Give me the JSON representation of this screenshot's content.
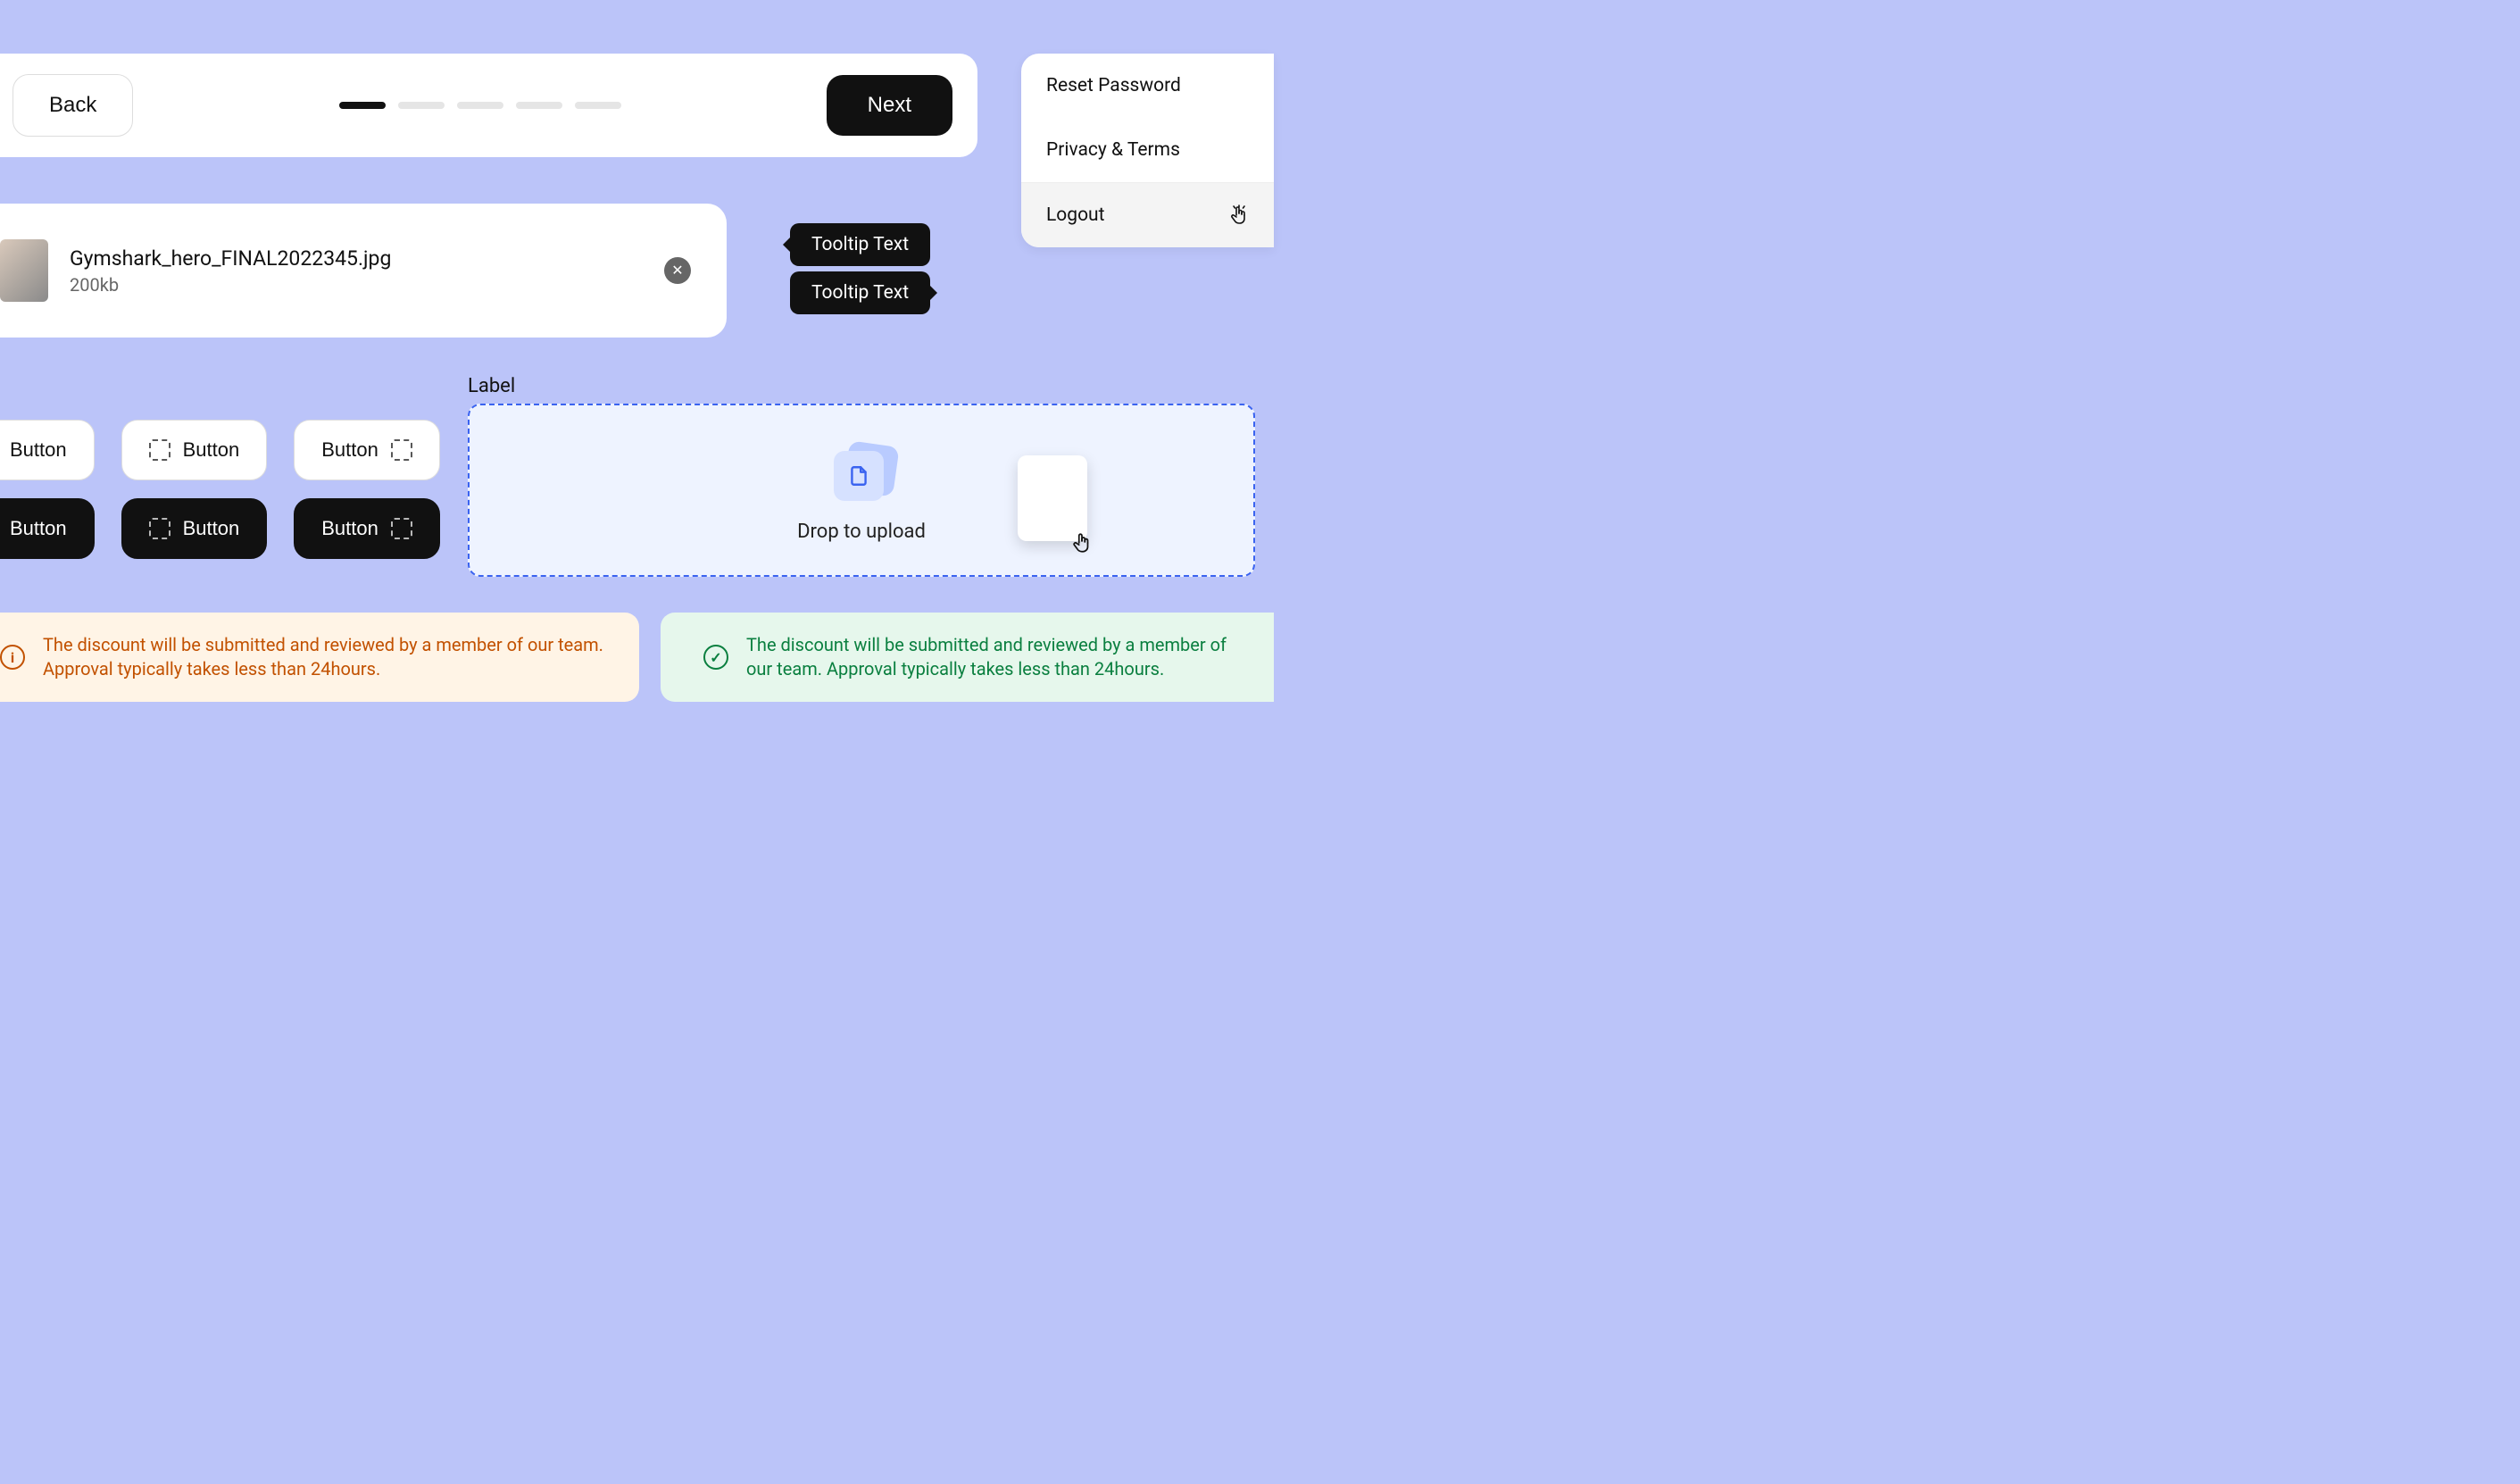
{
  "stepper": {
    "back_label": "Back",
    "next_label": "Next",
    "active_step": 0,
    "total_steps": 5
  },
  "menu": {
    "items": [
      {
        "label": "Reset Password"
      },
      {
        "label": "Privacy & Terms"
      },
      {
        "label": "Logout",
        "hovered": true
      }
    ]
  },
  "file": {
    "name": "Gymshark_hero_FINAL2022345.jpg",
    "size": "200kb"
  },
  "tooltips": {
    "a": "Tooltip Text",
    "b": "Tooltip Text"
  },
  "buttons": {
    "label": "Button"
  },
  "dropzone": {
    "label": "Label",
    "text": "Drop to upload"
  },
  "alerts": {
    "warn": "The discount will be submitted and reviewed by a member of our team. Approval typically takes less than 24hours.",
    "ok": "The discount will be submitted and reviewed by a member of our team. Approval typically takes less than 24hours."
  },
  "colors": {
    "accent": "#3A63F0",
    "warn": "#C25100",
    "ok": "#0A7F3F"
  }
}
